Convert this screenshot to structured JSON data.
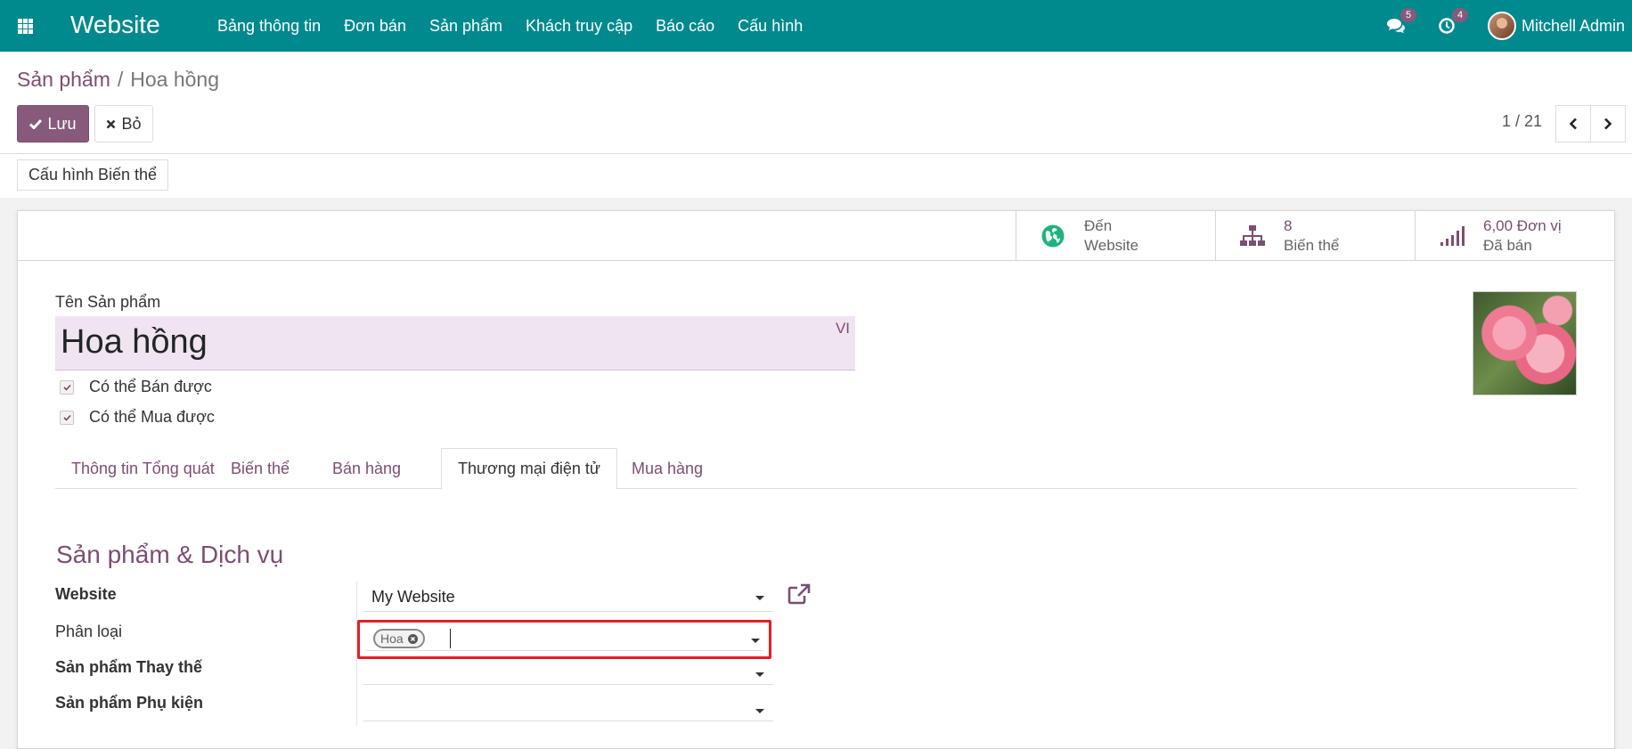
{
  "navbar": {
    "brand": "Website",
    "menu": [
      "Bảng thông tin",
      "Đơn bán",
      "Sản phẩm",
      "Khách truy cập",
      "Báo cáo",
      "Cấu hình"
    ],
    "messages_count": "5",
    "activities_count": "4",
    "user_name": "Mitchell Admin"
  },
  "breadcrumb": {
    "parent": "Sản phẩm",
    "separator": "/",
    "current": "Hoa hồng"
  },
  "actions": {
    "save_label": "Lưu",
    "discard_label": "Bỏ"
  },
  "pager": {
    "value": "1 / 21"
  },
  "variant_config_label": "Cấu hình Biến thể",
  "smart_buttons": [
    {
      "value": "Đến",
      "label": "Website",
      "icon": "globe-icon"
    },
    {
      "value": "8",
      "label": "Biến thể",
      "icon": "sitemap-icon"
    },
    {
      "value": "6,00 Đơn vị",
      "label": "Đã bán",
      "icon": "signal-icon"
    }
  ],
  "product": {
    "name_label": "Tên Sản phẩm",
    "name": "Hoa hồng",
    "lang": "VI",
    "can_be_sold_label": "Có thể Bán được",
    "can_be_sold": true,
    "can_be_purchased_label": "Có thể Mua được",
    "can_be_purchased": true
  },
  "tabs": [
    "Thông tin Tổng quát",
    "Biến thể",
    "Bán hàng",
    "Thương mại điện tử",
    "Mua hàng"
  ],
  "active_tab": "Thương mại điện tử",
  "ecommerce": {
    "group_title": "Sản phẩm & Dịch vụ",
    "website_label": "Website",
    "website_value": "My Website",
    "category_label": "Phân loại",
    "category_tags": [
      "Hoa"
    ],
    "alternative_label": "Sản phẩm Thay thế",
    "accessory_label": "Sản phẩm Phụ kiện"
  },
  "colors": {
    "navbar": "#018a8e",
    "primary": "#875a7b",
    "highlight": "#e21f26"
  }
}
